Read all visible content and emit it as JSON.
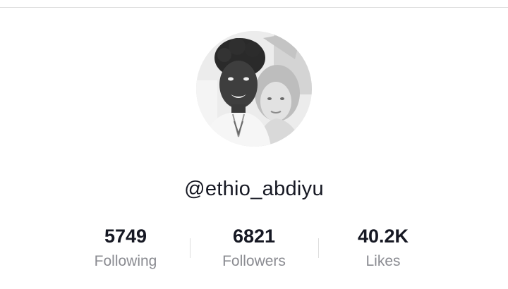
{
  "profile": {
    "username": "@ethio_abdiyu",
    "avatar": "profile-photo"
  },
  "stats": {
    "following": {
      "value": "5749",
      "label": "Following"
    },
    "followers": {
      "value": "6821",
      "label": "Followers"
    },
    "likes": {
      "value": "40.2K",
      "label": "Likes"
    }
  },
  "colors": {
    "text_primary": "#161823",
    "text_secondary": "#8a8b91",
    "divider": "#dddddd"
  }
}
